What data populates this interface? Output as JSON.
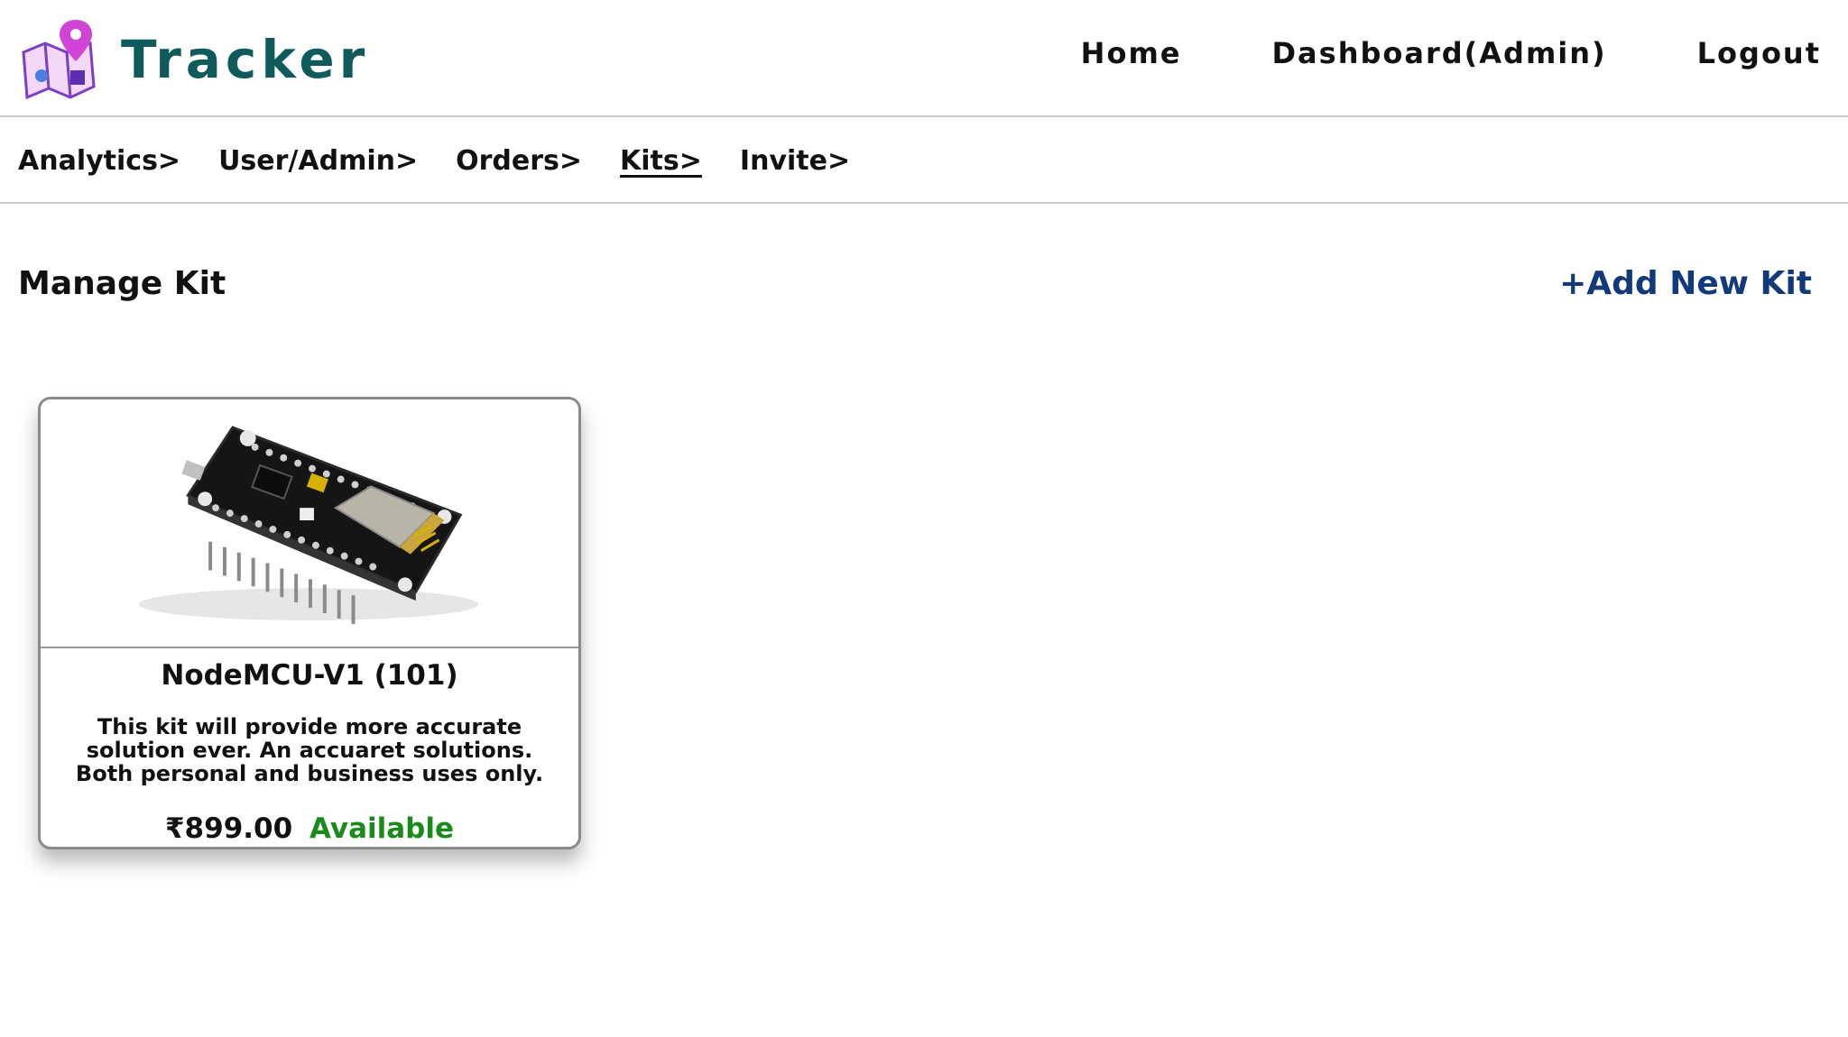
{
  "brand": {
    "name": "Tracker",
    "logo_icon": "map-pin-logo-icon"
  },
  "top_nav": [
    {
      "label": "Home"
    },
    {
      "label": "Dashboard(Admin)"
    },
    {
      "label": "Logout"
    }
  ],
  "sub_nav": [
    {
      "label": "Analytics>",
      "active": false
    },
    {
      "label": "User/Admin>",
      "active": false
    },
    {
      "label": "Orders>",
      "active": false
    },
    {
      "label": "Kits>",
      "active": true
    },
    {
      "label": "Invite>",
      "active": false
    }
  ],
  "page": {
    "title": "Manage Kit",
    "add_button": "+Add New Kit"
  },
  "kits": [
    {
      "name": "NodeMCU-V1 (101)",
      "description": "This kit will provide more accurate solution ever. An accuaret solutions. Both personal and business uses only.",
      "price": "₹899.00",
      "status": "Available",
      "image_icon": "nodemcu-board-icon"
    }
  ],
  "colors": {
    "brand": "#0f5a5a",
    "link": "#123a7a",
    "available": "#1a8a1a"
  }
}
